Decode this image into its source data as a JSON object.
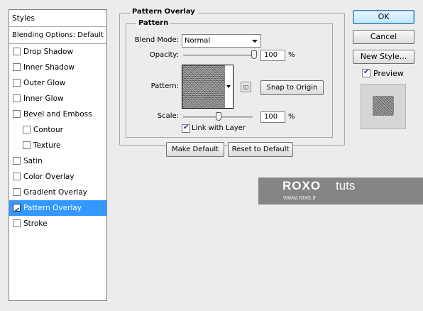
{
  "left_panel": {
    "header": "Styles",
    "blending_options": "Blending Options: Default",
    "items": [
      {
        "label": "Drop Shadow",
        "checked": false
      },
      {
        "label": "Inner Shadow",
        "checked": false
      },
      {
        "label": "Outer Glow",
        "checked": false
      },
      {
        "label": "Inner Glow",
        "checked": false
      },
      {
        "label": "Bevel and Emboss",
        "checked": false
      },
      {
        "label": "Contour",
        "checked": false
      },
      {
        "label": "Texture",
        "checked": false
      },
      {
        "label": "Satin",
        "checked": false
      },
      {
        "label": "Color Overlay",
        "checked": false
      },
      {
        "label": "Gradient Overlay",
        "checked": false
      },
      {
        "label": "Pattern Overlay",
        "checked": true,
        "selected": true
      },
      {
        "label": "Stroke",
        "checked": false
      }
    ]
  },
  "pattern_overlay": {
    "group_title": "Pattern Overlay",
    "subgroup_title": "Pattern",
    "blend_mode_label": "Blend Mode:",
    "blend_mode_value": "Normal",
    "opacity_label": "Opacity:",
    "opacity_value": "100",
    "opacity_unit": "%",
    "opacity_level": 1.0,
    "pattern_label": "Pattern:",
    "snap_to_origin": "Snap to Origin",
    "scale_label": "Scale:",
    "scale_value": "100",
    "scale_unit": "%",
    "scale_level": 0.5,
    "link_with_layer_label": "Link with Layer",
    "link_with_layer_checked": true,
    "make_default": "Make Default",
    "reset_to_default": "Reset to Default"
  },
  "right_buttons": {
    "ok": "OK",
    "cancel": "Cancel",
    "new_style": "New Style...",
    "preview_label": "Preview",
    "preview_checked": true
  },
  "watermark": {
    "logo": "ROXO",
    "tuts": "tuts",
    "url": "www.roxo.ir"
  },
  "colors": {
    "selection": "#3399ff",
    "background": "#ececec",
    "watermark_bg": "#858585"
  }
}
